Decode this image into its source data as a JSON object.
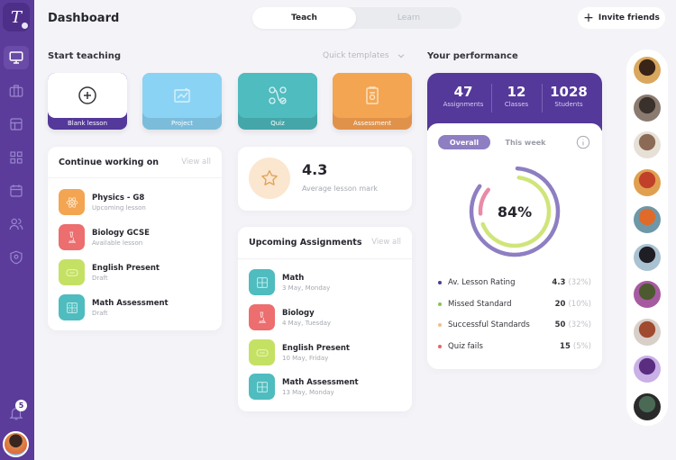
{
  "app": {
    "logo_glyph": "T",
    "page_title": "Dashboard"
  },
  "sidebar": {
    "items": [
      {
        "name": "monitor",
        "active": true
      },
      {
        "name": "briefcase",
        "active": false
      },
      {
        "name": "layout",
        "active": false
      },
      {
        "name": "grid",
        "active": false
      },
      {
        "name": "calendar",
        "active": false
      },
      {
        "name": "users",
        "active": false
      },
      {
        "name": "shield",
        "active": false
      }
    ],
    "notifications_count": "5"
  },
  "header": {
    "tabs": [
      {
        "label": "Teach",
        "active": true
      },
      {
        "label": "Learn",
        "active": false
      }
    ],
    "invite_label": "Invite friends"
  },
  "start_teaching": {
    "title": "Start teaching",
    "quick_templates_label": "Quick templates",
    "tiles": [
      {
        "label": "Blank lesson",
        "icon": "plus-circle-icon",
        "color": "#ffffff",
        "bar_color": "#54389a"
      },
      {
        "label": "Project",
        "icon": "project-icon",
        "color": "#8bd3f4",
        "bar_color": "#7bbcdb"
      },
      {
        "label": "Quiz",
        "icon": "quiz-icon",
        "color": "#4fbcbf",
        "bar_color": "#45a6a9"
      },
      {
        "label": "Assessment",
        "icon": "clipboard-icon",
        "color": "#f3a552",
        "bar_color": "#e0924a"
      }
    ]
  },
  "continue_working": {
    "title": "Continue working on",
    "view_all": "View all",
    "items": [
      {
        "title": "Physics - G8",
        "subtitle": "Upcoming lesson",
        "color": "#f3a552",
        "icon": "atom-icon"
      },
      {
        "title": "Biology GCSE",
        "subtitle": "Available lesson",
        "color": "#ec6e6e",
        "icon": "microscope-icon"
      },
      {
        "title": "English Present",
        "subtitle": "Draft",
        "color": "#c5e163",
        "icon": "chat-icon"
      },
      {
        "title": "Math Assessment",
        "subtitle": "Draft",
        "color": "#4fbcbf",
        "icon": "calculator-icon"
      }
    ]
  },
  "rating": {
    "value": "4.3",
    "label": "Average lesson mark"
  },
  "upcoming": {
    "title": "Upcoming Assignments",
    "view_all": "View all",
    "items": [
      {
        "title": "Math",
        "subtitle": "3 May, Monday",
        "color": "#4fbcbf",
        "icon": "calculator-icon"
      },
      {
        "title": "Biology",
        "subtitle": "4 May, Tuesday",
        "color": "#ec6e6e",
        "icon": "microscope-icon"
      },
      {
        "title": "English Present",
        "subtitle": "10 May, Friday",
        "color": "#c5e163",
        "icon": "chat-icon"
      },
      {
        "title": "Math Assessment",
        "subtitle": "13 May, Monday",
        "color": "#4fbcbf",
        "icon": "calculator-icon"
      }
    ]
  },
  "performance": {
    "title": "Your performance",
    "stats": [
      {
        "value": "47",
        "label": "Assignments"
      },
      {
        "value": "12",
        "label": "Classes"
      },
      {
        "value": "1028",
        "label": "Students"
      }
    ],
    "tabs": [
      {
        "label": "Overall",
        "active": true
      },
      {
        "label": "This week",
        "active": false
      }
    ],
    "center_value": "84%",
    "rings": {
      "outer_fraction": 0.84,
      "inner_green_fraction": 0.67,
      "inner_pink_fraction": 0.12
    },
    "colors": {
      "outer": "#8e7ec2",
      "green": "#cfe57a",
      "pink": "#e88aa8"
    },
    "legend": [
      {
        "label": "Av. Lesson Rating",
        "value": "4.3",
        "pct": "(32%)",
        "color": "#4d3e8a"
      },
      {
        "label": "Missed Standard",
        "value": "20",
        "pct": "(10%)",
        "color": "#8cc152"
      },
      {
        "label": "Successful Standards",
        "value": "50",
        "pct": "(32%)",
        "color": "#f0c087"
      },
      {
        "label": "Quiz fails",
        "value": "15",
        "pct": "(5%)",
        "color": "#e06666"
      }
    ]
  },
  "friends": [
    {
      "name": "friend-1",
      "bg": "#d9a85e",
      "fg": "#3a2418"
    },
    {
      "name": "friend-2",
      "bg": "#8a7a70",
      "fg": "#3a302c"
    },
    {
      "name": "friend-3",
      "bg": "#e7e0d6",
      "fg": "#8b6b55"
    },
    {
      "name": "friend-4",
      "bg": "#e0a050",
      "fg": "#c0402a"
    },
    {
      "name": "friend-5",
      "bg": "#6e97a8",
      "fg": "#e06a2a"
    },
    {
      "name": "friend-6",
      "bg": "#a9c2d2",
      "fg": "#1e1e24"
    },
    {
      "name": "friend-7",
      "bg": "#a65aa0",
      "fg": "#4d5a30"
    },
    {
      "name": "friend-8",
      "bg": "#d8cfc8",
      "fg": "#a04a30"
    },
    {
      "name": "friend-9",
      "bg": "#c9b0e6",
      "fg": "#5a2d80"
    },
    {
      "name": "friend-10",
      "bg": "#2a2a2a",
      "fg": "#4a6a55"
    }
  ]
}
